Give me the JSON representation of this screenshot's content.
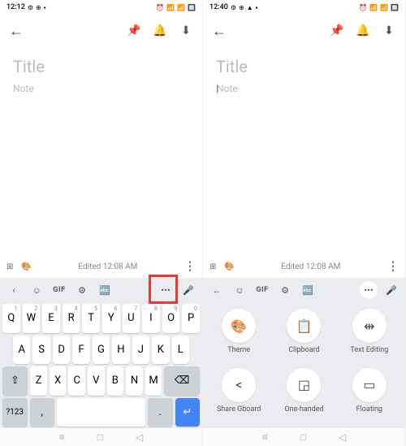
{
  "left": {
    "time": "12:12",
    "title_placeholder": "Title",
    "note_placeholder": "Note",
    "edited": "Edited 12:08 AM",
    "kb_tools": {
      "gif": "GIF"
    },
    "row1": [
      "Q",
      "W",
      "E",
      "R",
      "T",
      "Y",
      "U",
      "I",
      "O",
      "P"
    ],
    "row1_sup": [
      "1",
      "2",
      "3",
      "4",
      "5",
      "6",
      "7",
      "8",
      "9",
      "0"
    ],
    "row2": [
      "A",
      "S",
      "D",
      "F",
      "G",
      "H",
      "J",
      "K",
      "L"
    ],
    "row3": [
      "Z",
      "X",
      "C",
      "V",
      "B",
      "N",
      "M"
    ],
    "sym": "?123",
    "comma": ",",
    "period": "."
  },
  "right": {
    "time": "12:40",
    "title_placeholder": "Title",
    "note_placeholder": "Note",
    "edited": "Edited 12:08 AM",
    "kb_tools": {
      "gif": "GIF"
    },
    "grid": [
      {
        "icon": "🎨",
        "label": "Theme"
      },
      {
        "icon": "📋",
        "label": "Clipboard"
      },
      {
        "icon": "⇹",
        "label": "Text Editing"
      },
      {
        "icon": "<",
        "label": "Share Gboard"
      },
      {
        "icon": "◲",
        "label": "One-handed"
      },
      {
        "icon": "▭",
        "label": "Floating"
      }
    ]
  }
}
